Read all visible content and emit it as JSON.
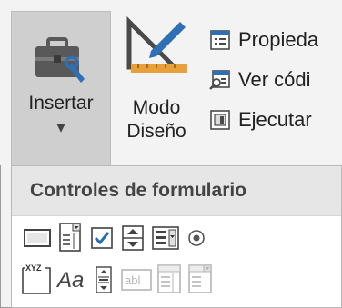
{
  "ribbon": {
    "insertar": {
      "label": "Insertar",
      "dropdown_arrow": "▾",
      "icon": "toolbox-icon"
    },
    "modo_diseno": {
      "label_line1": "Modo",
      "label_line2": "Diseño",
      "icon": "design-mode-icon"
    },
    "small_buttons": [
      {
        "label": "Propieda",
        "icon": "properties-icon"
      },
      {
        "label": "Ver códi",
        "icon": "view-code-icon"
      },
      {
        "label": "Ejecutar",
        "icon": "run-dialog-icon"
      }
    ]
  },
  "panel": {
    "title": "Controles de formulario",
    "row1": [
      {
        "name": "button-control",
        "icon": "button-icon"
      },
      {
        "name": "combo-box-control",
        "icon": "combo-box-icon"
      },
      {
        "name": "check-box-control",
        "icon": "check-box-icon"
      },
      {
        "name": "spin-button-control",
        "icon": "spin-button-icon"
      },
      {
        "name": "list-box-control",
        "icon": "list-box-icon"
      },
      {
        "name": "option-button-control",
        "icon": "option-button-icon"
      }
    ],
    "row2": [
      {
        "name": "group-box-control",
        "icon": "group-box-icon",
        "text": "XYZ"
      },
      {
        "name": "label-control",
        "icon": "label-icon",
        "text": "Aa"
      },
      {
        "name": "scroll-bar-control",
        "icon": "scroll-bar-icon"
      },
      {
        "name": "text-field-control",
        "icon": "text-field-icon",
        "text": "abl",
        "disabled": true
      },
      {
        "name": "combo-list-edit-control",
        "icon": "combo-list-edit-icon",
        "disabled": true
      },
      {
        "name": "combo-drop-edit-control",
        "icon": "combo-drop-edit-icon",
        "disabled": true
      }
    ]
  },
  "colors": {
    "accent_blue": "#2b6cb0",
    "icon_gray": "#4a4a4a",
    "disabled_gray": "#b5b5b5",
    "tool_orange": "#e8a13a"
  }
}
